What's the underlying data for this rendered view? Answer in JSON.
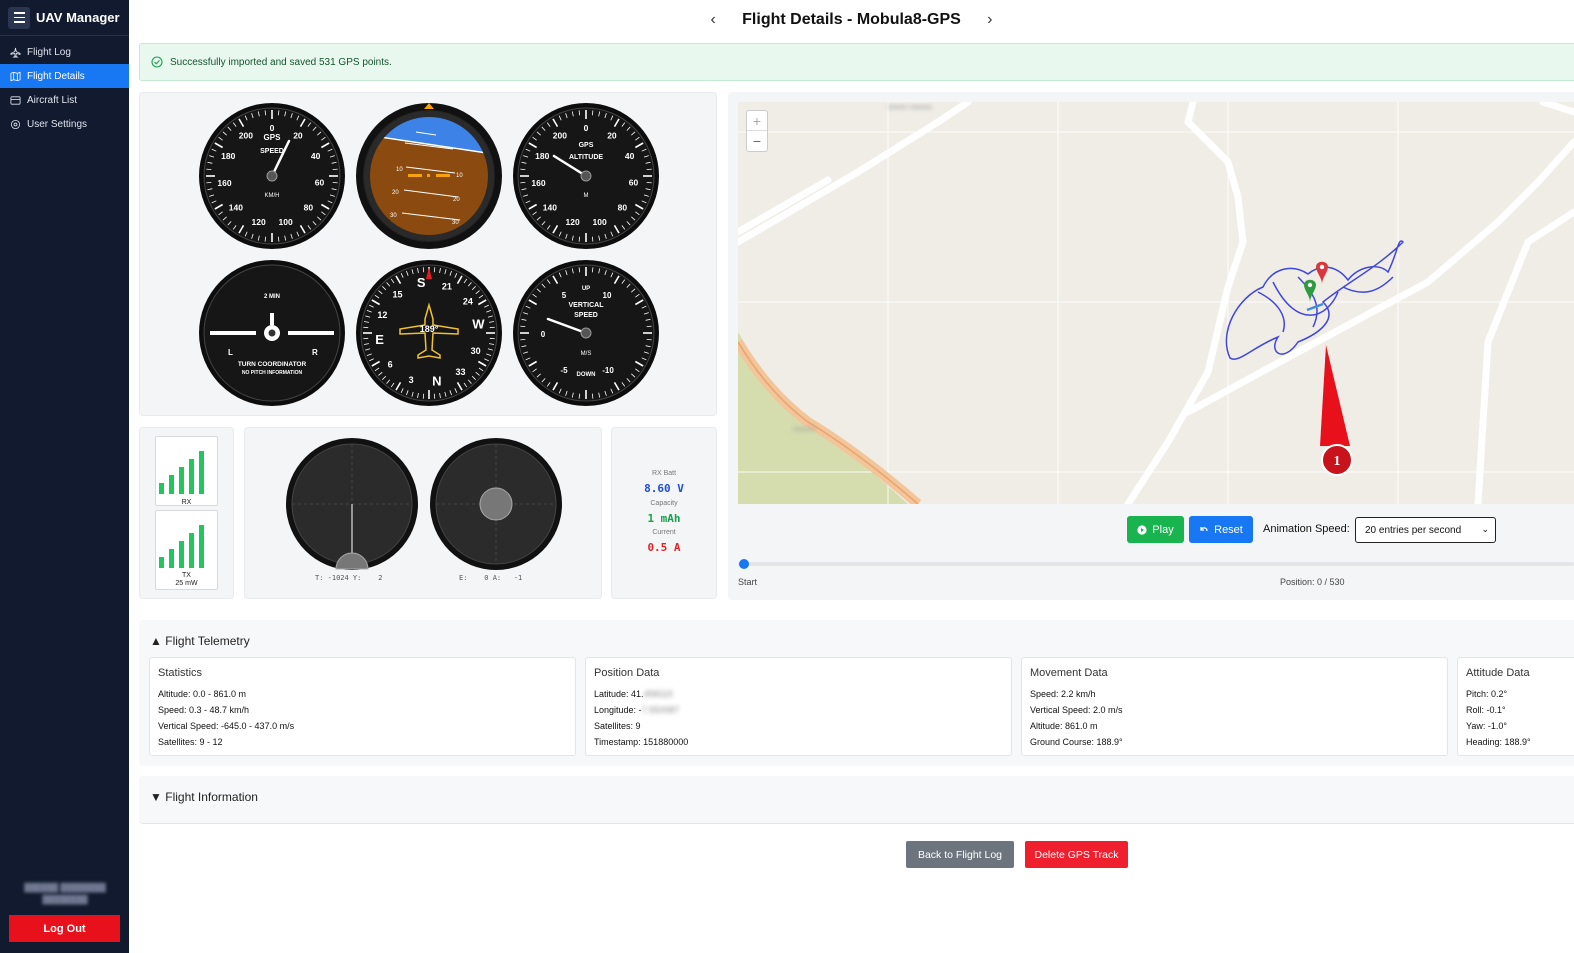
{
  "app": {
    "title": "UAV Manager"
  },
  "sidebar": {
    "items": [
      {
        "label": "Flight Log",
        "icon": "plane-icon"
      },
      {
        "label": "Flight Details",
        "icon": "map-icon"
      },
      {
        "label": "Aircraft List",
        "icon": "list-icon"
      },
      {
        "label": "User Settings",
        "icon": "gear-icon"
      }
    ],
    "active_index": 1,
    "logout_label": "Log Out"
  },
  "header": {
    "title": "Flight Details - Mobula8-GPS"
  },
  "alert": {
    "message": "Successfully imported and saved 531 GPS points."
  },
  "instruments": {
    "speed": {
      "title": "GPS",
      "subtitle": "SPEED",
      "unit": "KM/H",
      "ticks": [
        "0",
        "20",
        "40",
        "60",
        "80",
        "100",
        "120",
        "140",
        "160",
        "180",
        "200"
      ]
    },
    "attitude": {
      "pitch_marks": [
        "10",
        "20",
        "30"
      ]
    },
    "altitude": {
      "title": "GPS",
      "subtitle": "ALTITUDE",
      "unit": "M",
      "ticks": [
        "0",
        "20",
        "40",
        "60",
        "80",
        "100",
        "120",
        "140",
        "160",
        "180",
        "200"
      ]
    },
    "turn": {
      "top": "2 MIN",
      "left": "L",
      "right": "R",
      "title": "TURN COORDINATOR",
      "subtitle": "NO PITCH INFORMATION"
    },
    "heading": {
      "value": "189°",
      "labels": [
        "S",
        "21",
        "24",
        "W",
        "30",
        "33",
        "N",
        "3",
        "6",
        "E",
        "12",
        "15"
      ]
    },
    "vspeed": {
      "title": "VERTICAL",
      "subtitle": "SPEED",
      "up": "UP",
      "down": "DOWN",
      "unit": "M/S",
      "ticks": [
        "0",
        "5",
        "10",
        "-5",
        "-10"
      ]
    }
  },
  "signal": {
    "rx_label": "RX",
    "tx_label": "TX",
    "tx_power": "25 mW",
    "rx_bars": 5,
    "tx_bars": 5
  },
  "sticks": {
    "left_readout": "T: -1024 Y:    2",
    "right_readout": "E:    0 A:   -1"
  },
  "battery": {
    "rx_batt_label": "RX Batt",
    "rx_batt_value": "8.60 V",
    "capacity_label": "Capacity",
    "capacity_value": "1 mAh",
    "current_label": "Current",
    "current_value": "0.5 A",
    "colors": {
      "voltage": "#1d4ed8",
      "capacity": "#16a34a",
      "current": "#dc2626"
    }
  },
  "map": {
    "marker_label": "1",
    "track_color": "#3f46e0"
  },
  "playback": {
    "play_label": "Play",
    "reset_label": "Reset",
    "speed_label": "Animation Speed:",
    "speed_value": "20 entries per second",
    "start_label": "Start",
    "position_label": "Position: 0 / 530",
    "position": 0
  },
  "telemetry": {
    "title": "Flight Telemetry",
    "cards": [
      {
        "title": "Statistics",
        "lines": [
          "Altitude: 0.0 - 861.0 m",
          "Speed: 0.3 - 48.7 km/h",
          "Vertical Speed: -645.0 - 437.0 m/s",
          "Satellites: 9 - 12"
        ]
      },
      {
        "title": "Position Data",
        "lines": [
          "Latitude: 41.",
          "Longitude: -",
          "Satellites: 9",
          "Timestamp: 151880000"
        ]
      },
      {
        "title": "Movement Data",
        "lines": [
          "Speed: 2.2 km/h",
          "Vertical Speed: 2.0 m/s",
          "Altitude: 861.0 m",
          "Ground Course: 188.9°"
        ]
      },
      {
        "title": "Attitude Data",
        "lines": [
          "Pitch: 0.2°",
          "Roll: -0.1°",
          "Yaw: -1.0°",
          "Heading: 188.9°"
        ]
      }
    ]
  },
  "flight_info": {
    "title": "Flight Information"
  },
  "footer": {
    "back_label": "Back to Flight Log",
    "delete_label": "Delete GPS Track"
  }
}
